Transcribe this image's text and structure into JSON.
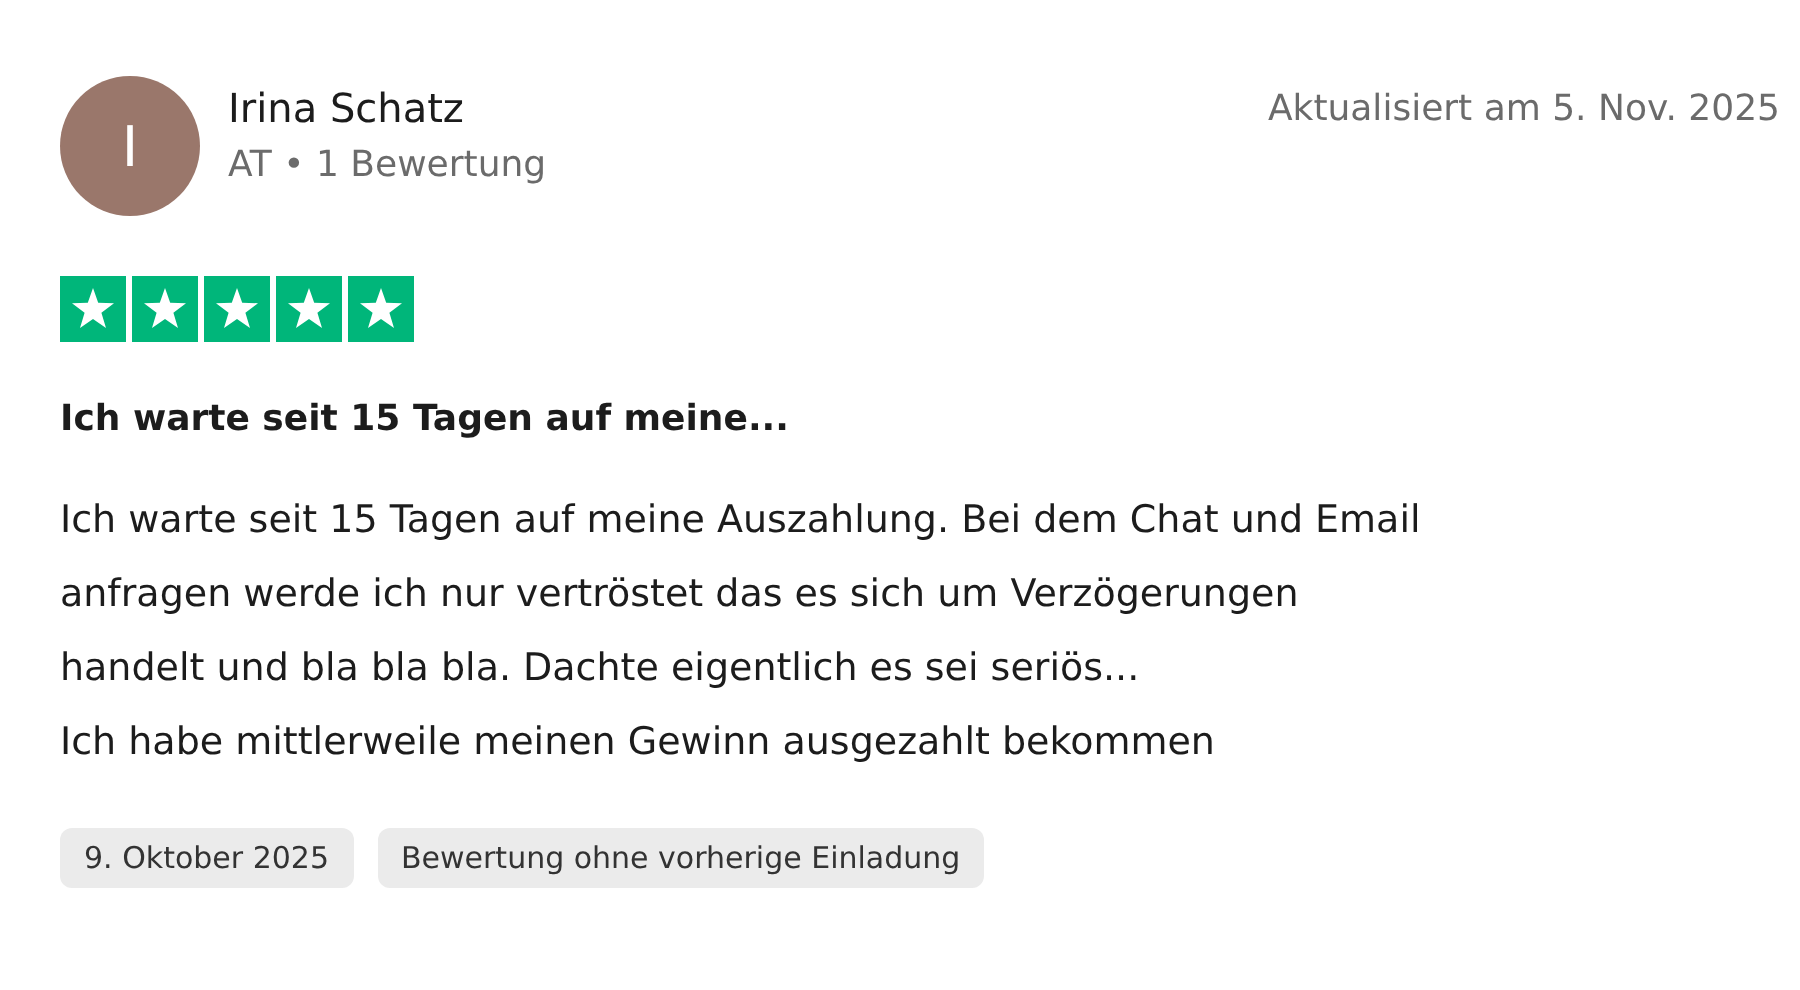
{
  "review": {
    "avatar_initial": "I",
    "author": "Irina Schatz",
    "meta": "AT • 1 Bewertung",
    "updated": "Aktualisiert am 5. Nov. 2025",
    "stars": 5,
    "title": "Ich warte seit 15 Tagen auf meine...",
    "body": [
      "Ich warte seit 15 Tagen auf meine Auszahlung. Bei dem Chat und Email",
      "anfragen werde ich nur vertröstet das es sich um Verzögerungen",
      "handelt und bla bla bla. Dachte eigentlich es sei seriös...",
      "Ich habe mittlerweile meinen Gewinn ausgezahlt bekommen"
    ],
    "tags": [
      "9. Oktober 2025",
      "Bewertung ohne vorherige Einladung"
    ]
  }
}
